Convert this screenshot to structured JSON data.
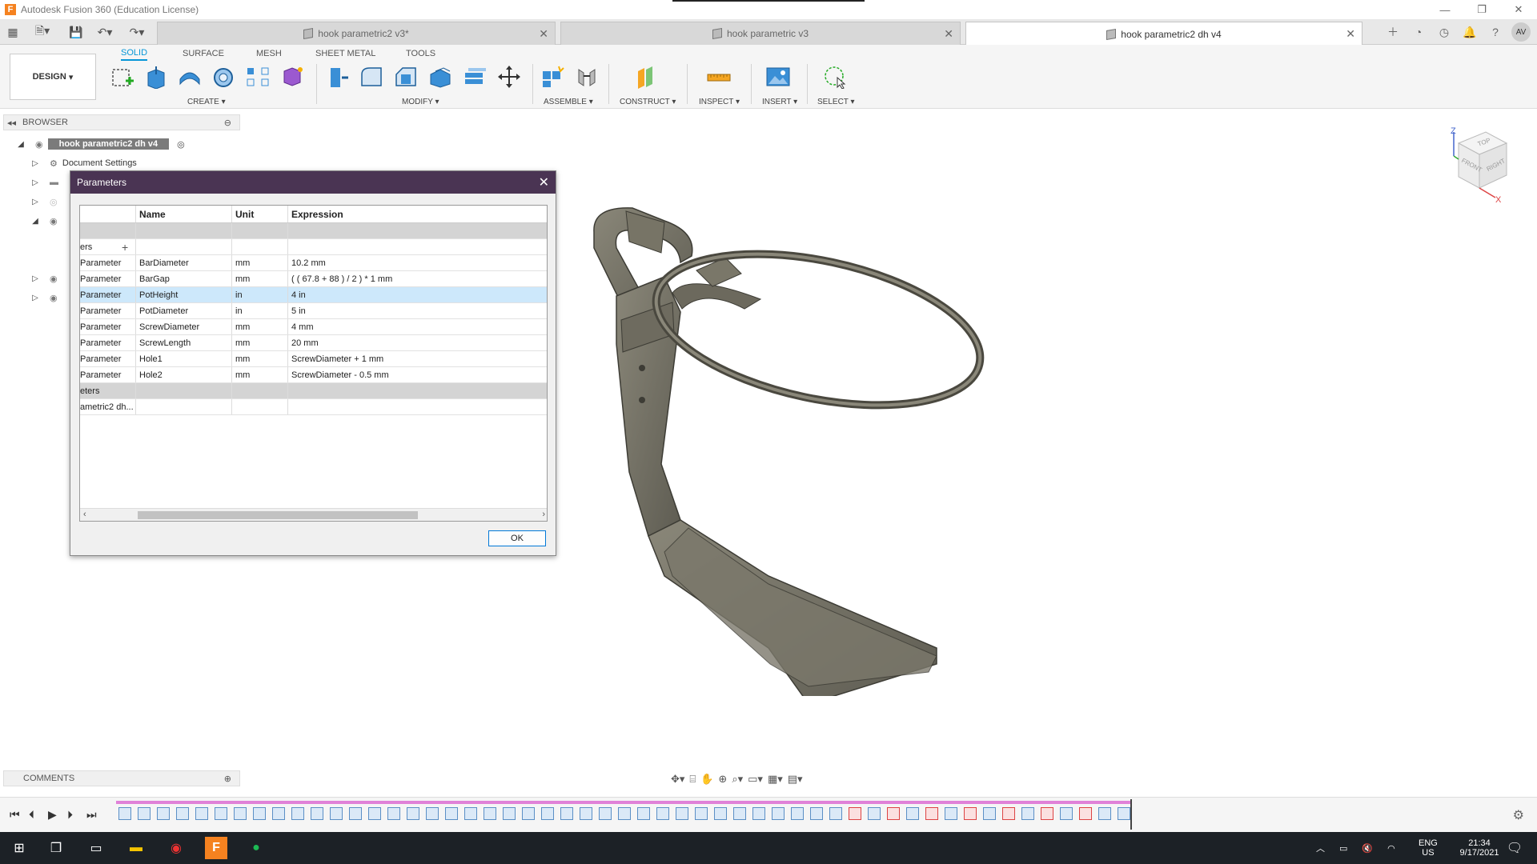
{
  "window": {
    "title": "Autodesk Fusion 360 (Education License)",
    "minimize": "—",
    "restore": "❐",
    "close": "✕"
  },
  "tabs": [
    {
      "label": "hook parametric2 v3*",
      "active": false
    },
    {
      "label": "hook parametric v3",
      "active": false
    },
    {
      "label": "hook parametric2 dh v4",
      "active": true
    }
  ],
  "user_initials": "AV",
  "ribbon": {
    "workspace": "DESIGN",
    "tabs": [
      "SOLID",
      "SURFACE",
      "MESH",
      "SHEET METAL",
      "TOOLS"
    ],
    "groups": {
      "create": "CREATE",
      "modify": "MODIFY",
      "assemble": "ASSEMBLE",
      "construct": "CONSTRUCT",
      "inspect": "INSPECT",
      "insert": "INSERT",
      "select": "SELECT"
    }
  },
  "browser": {
    "header": "BROWSER",
    "root": "hook parametric2 dh v4",
    "items": [
      "Document Settings"
    ]
  },
  "dialog": {
    "title": "Parameters",
    "columns": {
      "c0": "",
      "name": "Name",
      "unit": "Unit",
      "expression": "Expression"
    },
    "group_user": "ers",
    "group_model": "eters",
    "model_row": "ametric2 dh...",
    "rows": [
      {
        "type": "Parameter",
        "name": "BarDiameter",
        "unit": "mm",
        "expression": "10.2 mm"
      },
      {
        "type": "Parameter",
        "name": "BarGap",
        "unit": "mm",
        "expression": "( ( 67.8 + 88 ) / 2 ) * 1 mm"
      },
      {
        "type": "Parameter",
        "name": "PotHeight",
        "unit": "in",
        "expression": "4 in"
      },
      {
        "type": "Parameter",
        "name": "PotDiameter",
        "unit": "in",
        "expression": "5 in"
      },
      {
        "type": "Parameter",
        "name": "ScrewDiameter",
        "unit": "mm",
        "expression": "4 mm"
      },
      {
        "type": "Parameter",
        "name": "ScrewLength",
        "unit": "mm",
        "expression": "20 mm"
      },
      {
        "type": "Parameter",
        "name": "Hole1",
        "unit": "mm",
        "expression": "ScrewDiameter + 1 mm"
      },
      {
        "type": "Parameter",
        "name": "Hole2",
        "unit": "mm",
        "expression": "ScrewDiameter - 0.5 mm"
      }
    ],
    "ok": "OK"
  },
  "comments": {
    "header": "COMMENTS"
  },
  "viewcube": {
    "top": "TOP",
    "front": "FRONT",
    "right": "RIGHT",
    "z": "Z",
    "x": "X"
  },
  "taskbar": {
    "lang": "ENG",
    "region": "US",
    "time": "21:34",
    "date": "9/17/2021"
  }
}
